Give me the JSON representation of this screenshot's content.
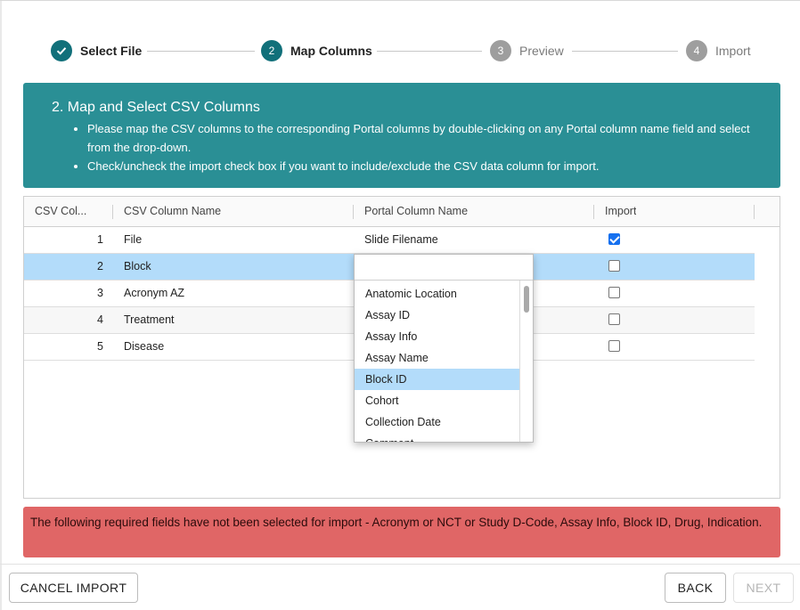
{
  "stepper": {
    "steps": [
      {
        "number": "",
        "label": "Select File",
        "state": "done",
        "icon": "check-icon"
      },
      {
        "number": "2",
        "label": "Map Columns",
        "state": "active"
      },
      {
        "number": "3",
        "label": "Preview",
        "state": "pending"
      },
      {
        "number": "4",
        "label": "Import",
        "state": "pending"
      }
    ]
  },
  "info": {
    "title": "2. Map and Select CSV Columns",
    "bullets": [
      "Please map the CSV columns to the corresponding Portal columns by double-clicking on any Portal column name field and select from the drop-down.",
      "Check/uncheck the import check box if you want to include/exclude the CSV data column for import."
    ]
  },
  "table": {
    "headers": {
      "csv_col": "CSV Col...",
      "csv_name": "CSV Column Name",
      "portal_name": "Portal Column Name",
      "import": "Import"
    },
    "rows": [
      {
        "num": "1",
        "name": "File",
        "portal": "Slide Filename",
        "import": true
      },
      {
        "num": "2",
        "name": "Block",
        "portal": "",
        "import": false
      },
      {
        "num": "3",
        "name": "Acronym AZ",
        "portal": "",
        "import": false
      },
      {
        "num": "4",
        "name": "Treatment",
        "portal": "",
        "import": false
      },
      {
        "num": "5",
        "name": "Disease",
        "portal": "",
        "import": false
      }
    ]
  },
  "dropdown": {
    "search_value": "",
    "options": [
      "Anatomic Location",
      "Assay ID",
      "Assay Info",
      "Assay Name",
      "Block ID",
      "Cohort",
      "Collection Date",
      "Comment"
    ],
    "selected": "Block ID"
  },
  "error": {
    "message": "The following required fields have not been selected for import - Acronym or NCT or Study D-Code, Assay Info, Block ID, Drug, Indication."
  },
  "footer": {
    "cancel_label": "CANCEL IMPORT",
    "back_label": "BACK",
    "next_label": "NEXT"
  },
  "colors": {
    "accent": "#11707a",
    "info_banner": "#2a8f95",
    "error_banner": "#e06666",
    "selection": "#b3dcfa"
  }
}
